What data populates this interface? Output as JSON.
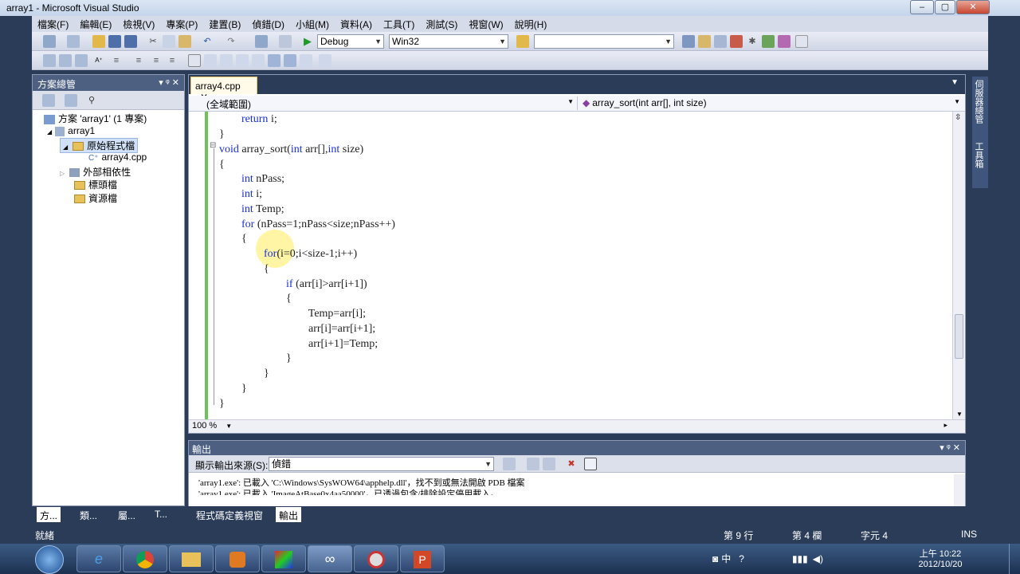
{
  "window": {
    "title": "array1 - Microsoft Visual Studio"
  },
  "menu": [
    "檔案(F)",
    "編輯(E)",
    "檢視(V)",
    "專案(P)",
    "建置(B)",
    "偵錯(D)",
    "小組(M)",
    "資料(A)",
    "工具(T)",
    "測試(S)",
    "視窗(W)",
    "說明(H)"
  ],
  "toolbar": {
    "config": "Debug",
    "platform": "Win32",
    "find": ""
  },
  "solution_explorer": {
    "title": "方案總管",
    "controls": "▾ ᵠ ✕",
    "items": [
      {
        "label": "方案 'array1' (1 專案)"
      },
      {
        "label": "array1"
      },
      {
        "label": "原始程式檔"
      },
      {
        "label": "array4.cpp"
      },
      {
        "label": "外部相依性"
      },
      {
        "label": "標頭檔"
      },
      {
        "label": "資源檔"
      }
    ]
  },
  "editor": {
    "tab": "array4.cpp",
    "scope": "(全域範圍)",
    "member": "array_sort(int arr[], int size)",
    "zoom": "100 %",
    "lines": [
      "        return i;",
      "}",
      "void array_sort(int arr[],int size)",
      "{",
      "        int nPass;",
      "        int i;",
      "        int Temp;",
      "        for (nPass=1;nPass<size;nPass++)",
      "        {",
      "                for(i=0;i<size-1;i++)",
      "                {",
      "                        if (arr[i]>arr[i+1])",
      "                        {",
      "                                Temp=arr[i];",
      "                                arr[i]=arr[i+1];",
      "                                arr[i+1]=Temp;",
      "                        }",
      "                }",
      "        }",
      "}"
    ]
  },
  "output": {
    "title": "輸出",
    "source_label": "顯示輸出來源(S):",
    "source_value": "偵錯",
    "lines": [
      "'array1.exe': 已載入 'C:\\Windows\\SysWOW64\\apphelp.dll'，找不到或無法開啟 PDB 檔案",
      "'array1.exe': 已載入 'ImageAtBase0x4aa50000'，已透過包含/排除設定停用載入。"
    ]
  },
  "bottom_tabs": [
    "方...",
    "類...",
    "屬...",
    "T...",
    "程式碼定義視窗",
    "輸出"
  ],
  "status": {
    "ready": "就緒",
    "line": "第 9 行",
    "col": "第 4 欄",
    "char": "字元 4",
    "mode": "INS"
  },
  "taskbar": {
    "time": "上午 10:22",
    "date": "2012/10/20",
    "tray": "中"
  },
  "side_tabs": [
    "伺服器總管",
    "工具箱"
  ]
}
